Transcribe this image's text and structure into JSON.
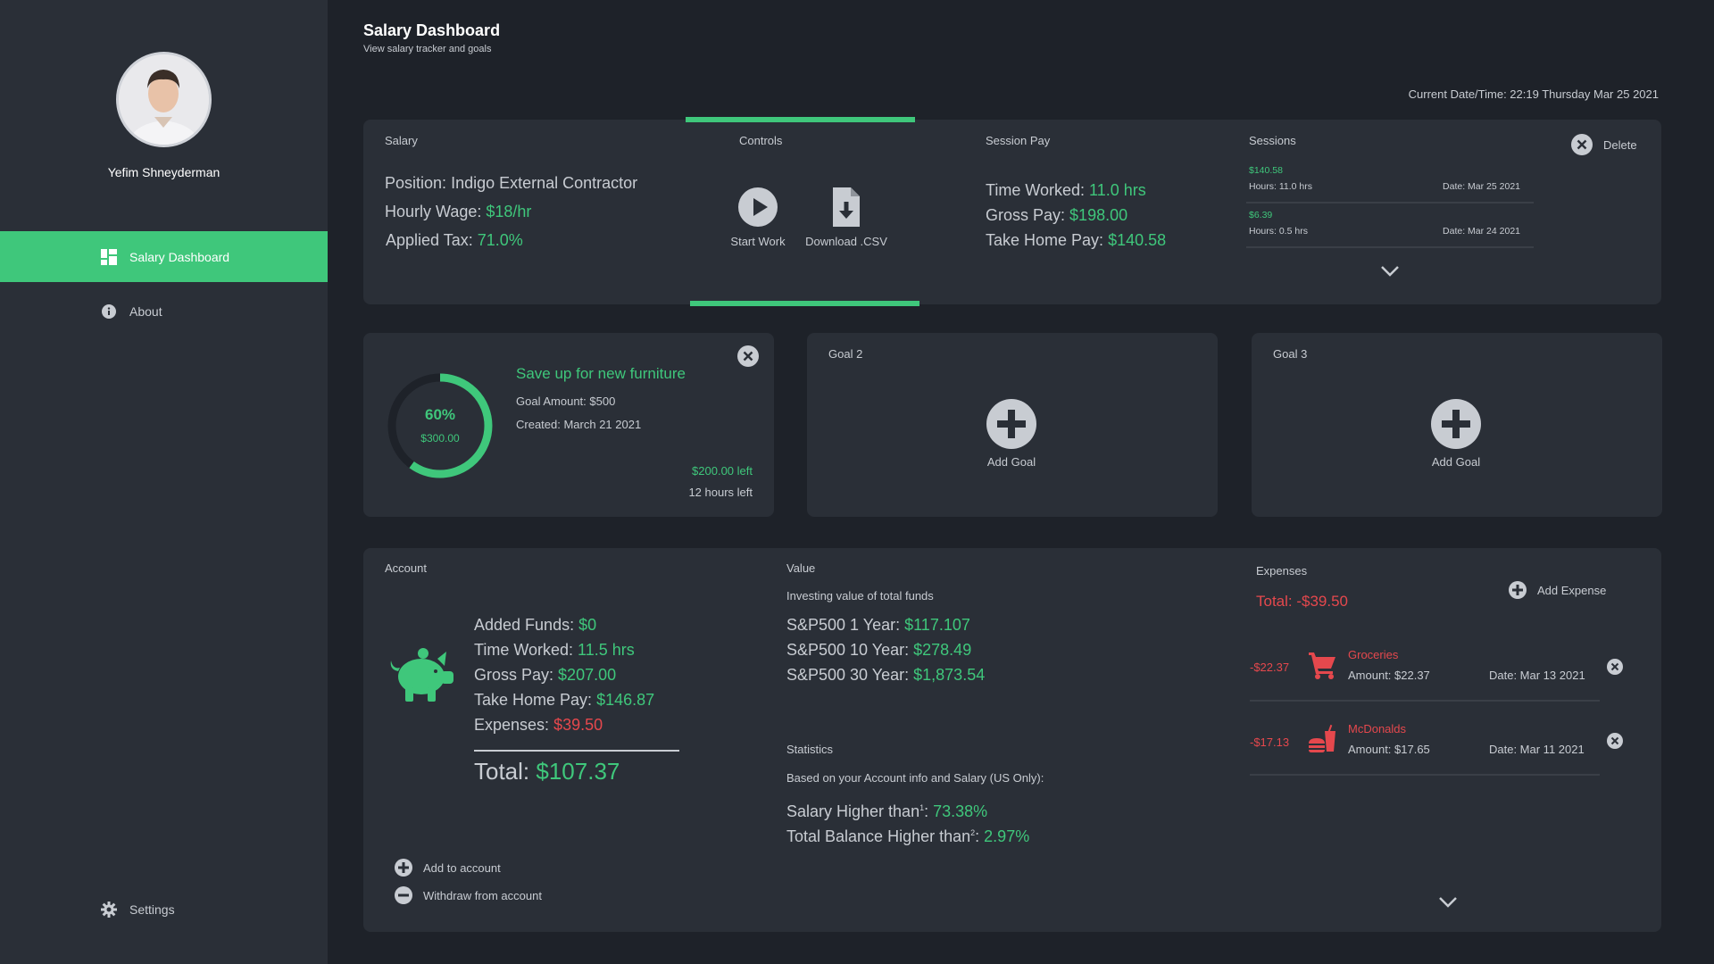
{
  "user": {
    "name": "Yefim Shneyderman"
  },
  "nav": {
    "items": [
      {
        "label": "Salary Dashboard",
        "icon": "dashboard-icon"
      },
      {
        "label": "About",
        "icon": "info-icon"
      }
    ],
    "settings": "Settings"
  },
  "header": {
    "title": "Salary Dashboard",
    "subtitle": "View salary tracker and goals",
    "datetime": "Current Date/Time: 22:19 Thursday Mar 25 2021"
  },
  "salary": {
    "label": "Salary",
    "position_label": "Position:",
    "position": "Indigo External Contractor",
    "wage_label": "Hourly Wage:",
    "wage": "$18/hr",
    "tax_label": "Applied Tax:",
    "tax": "71.0%"
  },
  "controls": {
    "label": "Controls",
    "start": "Start Work",
    "download": "Download .CSV"
  },
  "session_pay": {
    "label": "Session Pay",
    "time_label": "Time Worked:",
    "time": "11.0 hrs",
    "gross_label": "Gross Pay:",
    "gross": "$198.00",
    "take_label": "Take Home Pay:",
    "take": "$140.58"
  },
  "sessions": {
    "label": "Sessions",
    "delete": "Delete",
    "items": [
      {
        "amount": "$140.58",
        "hours": "Hours: 11.0 hrs",
        "date": "Date: Mar 25 2021"
      },
      {
        "amount": "$6.39",
        "hours": "Hours: 0.5 hrs",
        "date": "Date: Mar 24 2021"
      }
    ]
  },
  "goal1": {
    "title": "Save up for new furniture",
    "amount": "Goal Amount: $500",
    "created": "Created: March 21 2021",
    "percent_text": "60%",
    "saved": "$300.00",
    "progress": 0.6,
    "left": "$200.00 left",
    "hours_left": "12 hours left"
  },
  "goal2": {
    "label": "Goal 2",
    "add": "Add Goal"
  },
  "goal3": {
    "label": "Goal 3",
    "add": "Add Goal"
  },
  "account": {
    "label": "Account",
    "added_label": "Added Funds:",
    "added": "$0",
    "time_label": "Time Worked:",
    "time": "11.5 hrs",
    "gross_label": "Gross Pay:",
    "gross": "$207.00",
    "take_label": "Take Home Pay:",
    "take": "$146.87",
    "exp_label": "Expenses:",
    "exp": "$39.50",
    "total_label": "Total:",
    "total": "$107.37",
    "add": "Add to account",
    "withdraw": "Withdraw from account"
  },
  "value": {
    "label": "Value",
    "desc": "Investing value of total funds",
    "y1_label": "S&P500 1 Year:",
    "y1": "$117.107",
    "y10_label": "S&P500 10 Year:",
    "y10": "$278.49",
    "y30_label": "S&P500 30 Year:",
    "y30": "$1,873.54"
  },
  "stats": {
    "label": "Statistics",
    "desc": "Based on your Account info and Salary (US Only):",
    "salary_label": "Salary Higher than",
    "salary_sup": "1",
    "salary": "73.38%",
    "balance_label": "Total Balance Higher than",
    "balance_sup": "2",
    "balance": "2.97%"
  },
  "expenses": {
    "label": "Expenses",
    "total": "Total: -$39.50",
    "add": "Add Expense",
    "items": [
      {
        "delta": "-$22.37",
        "name": "Groceries",
        "amount": "Amount: $22.37",
        "date": "Date: Mar 13 2021",
        "icon": "cart-icon"
      },
      {
        "delta": "-$17.13",
        "name": "McDonalds",
        "amount": "Amount: $17.65",
        "date": "Date: Mar 11 2021",
        "icon": "fastfood-icon"
      }
    ]
  },
  "colors": {
    "accent": "#3fc77b",
    "negative": "#e5484d",
    "card": "#2a2f37",
    "background": "#1e2229"
  }
}
